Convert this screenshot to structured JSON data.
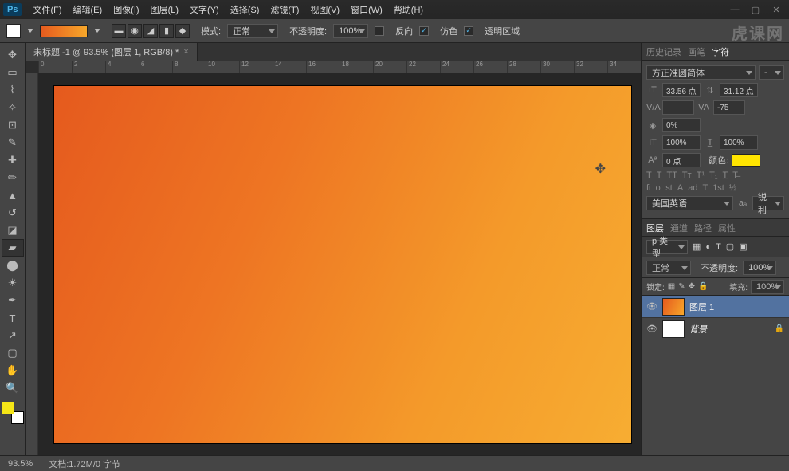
{
  "app": {
    "badge": "Ps"
  },
  "menu": [
    "文件(F)",
    "编辑(E)",
    "图像(I)",
    "图层(L)",
    "文字(Y)",
    "选择(S)",
    "滤镜(T)",
    "视图(V)",
    "窗口(W)",
    "帮助(H)"
  ],
  "optbar": {
    "mode_label": "模式:",
    "mode_value": "正常",
    "opacity_label": "不透明度:",
    "opacity_value": "100%",
    "reverse": "反向",
    "dither": "仿色",
    "trans": "透明区域"
  },
  "doc": {
    "tab": "未标题 -1 @ 93.5% (图层 1, RGB/8) *",
    "close": "×"
  },
  "ruler_top": [
    "0",
    "2",
    "4",
    "6",
    "8",
    "10",
    "12",
    "14",
    "16",
    "18",
    "20",
    "22",
    "24",
    "26",
    "28",
    "30",
    "32",
    "34"
  ],
  "char_panel": {
    "tabs": [
      "历史记录",
      "画笔",
      "字符"
    ],
    "font": "方正准圆简体",
    "size": "33.56 点",
    "leading": "31.12 点",
    "tracking": "-75",
    "va": "",
    "baseline": "0%",
    "h_scale": "100%",
    "v_scale": "100%",
    "shift": "0 点",
    "color_label": "颜色:",
    "lang": "美国英语",
    "aa": "锐利"
  },
  "layers_panel": {
    "tabs": [
      "图层",
      "通道",
      "路径",
      "属性"
    ],
    "kind": "p 类型",
    "blend": "正常",
    "opacity_label": "不透明度:",
    "opacity": "100%",
    "lock_label": "锁定:",
    "fill_label": "填充:",
    "fill": "100%",
    "items": [
      {
        "name": "图层 1"
      },
      {
        "name": "背景"
      }
    ]
  },
  "status": {
    "zoom": "93.5%",
    "doc": "文档:1.72M/0 字节"
  },
  "watermark": "虎课网"
}
